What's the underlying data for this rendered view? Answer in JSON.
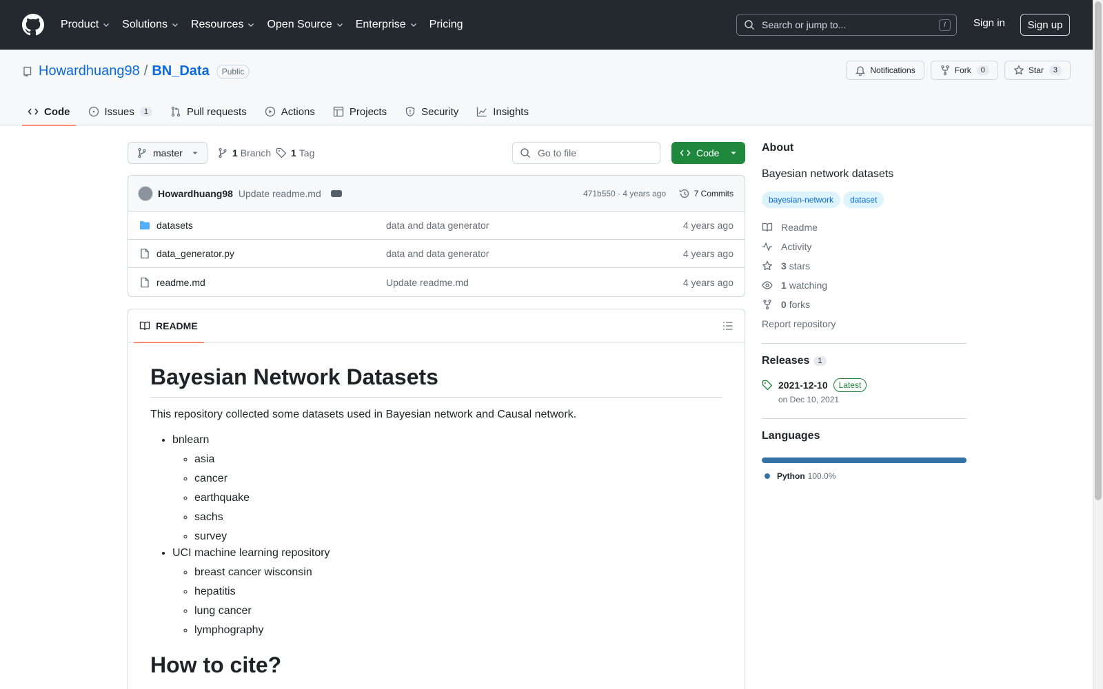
{
  "header": {
    "nav": [
      {
        "label": "Product",
        "dropdown": true
      },
      {
        "label": "Solutions",
        "dropdown": true
      },
      {
        "label": "Resources",
        "dropdown": true
      },
      {
        "label": "Open Source",
        "dropdown": true
      },
      {
        "label": "Enterprise",
        "dropdown": true
      },
      {
        "label": "Pricing",
        "dropdown": false
      }
    ],
    "search_placeholder": "Search or jump to...",
    "search_shortcut": "/",
    "sign_in": "Sign in",
    "sign_up": "Sign up"
  },
  "repo": {
    "owner": "Howardhuang98",
    "separator": "/",
    "name": "BN_Data",
    "visibility": "Public",
    "notifications": "Notifications",
    "fork_label": "Fork",
    "fork_count": "0",
    "star_label": "Star",
    "star_count": "3",
    "tabs": [
      {
        "label": "Code",
        "icon": "code-icon",
        "active": true,
        "count": ""
      },
      {
        "label": "Issues",
        "icon": "issue-icon",
        "active": false,
        "count": "1"
      },
      {
        "label": "Pull requests",
        "icon": "pull-request-icon",
        "active": false,
        "count": ""
      },
      {
        "label": "Actions",
        "icon": "play-icon",
        "active": false,
        "count": ""
      },
      {
        "label": "Projects",
        "icon": "table-icon",
        "active": false,
        "count": ""
      },
      {
        "label": "Security",
        "icon": "shield-icon",
        "active": false,
        "count": ""
      },
      {
        "label": "Insights",
        "icon": "graph-icon",
        "active": false,
        "count": ""
      }
    ]
  },
  "toolbar": {
    "branch": "master",
    "branch_count": "1",
    "branch_label": "Branch",
    "tag_count": "1",
    "tag_label": "Tag",
    "goto_placeholder": "Go to file",
    "code_button": "Code"
  },
  "commit": {
    "author": "Howardhuang98",
    "message": "Update readme.md",
    "sha_age": "471b550 · 4 years ago",
    "commits_count": "7 Commits"
  },
  "files": [
    {
      "name": "datasets",
      "type": "folder",
      "message": "data and data generator",
      "age": "4 years ago"
    },
    {
      "name": "data_generator.py",
      "type": "file",
      "message": "data and data generator",
      "age": "4 years ago"
    },
    {
      "name": "readme.md",
      "type": "file",
      "message": "Update readme.md",
      "age": "4 years ago"
    }
  ],
  "readme": {
    "tab_label": "README",
    "title": "Bayesian Network Datasets",
    "intro": "This repository collected some datasets used in Bayesian network and Causal network.",
    "groups": [
      {
        "label": "bnlearn",
        "items": [
          "asia",
          "cancer",
          "earthquake",
          "sachs",
          "survey"
        ]
      },
      {
        "label": "UCI machine learning repository",
        "items": [
          "breast cancer wisconsin",
          "hepatitis",
          "lung cancer",
          "lymphography"
        ]
      }
    ],
    "cite_heading": "How to cite?"
  },
  "about": {
    "title": "About",
    "description": "Bayesian network datasets",
    "topics": [
      "bayesian-network",
      "dataset"
    ],
    "links": {
      "readme": "Readme",
      "activity": "Activity",
      "stars_count": "3",
      "stars_label": "stars",
      "watching_count": "1",
      "watching_label": "watching",
      "forks_count": "0",
      "forks_label": "forks",
      "report": "Report repository"
    }
  },
  "releases": {
    "title": "Releases",
    "count": "1",
    "tag": "2021-12-10",
    "latest_badge": "Latest",
    "date": "on Dec 10, 2021"
  },
  "languages": {
    "title": "Languages",
    "items": [
      {
        "name": "Python",
        "percent": "100.0%",
        "fraction": 1.0,
        "color": "#3572A5"
      }
    ]
  }
}
